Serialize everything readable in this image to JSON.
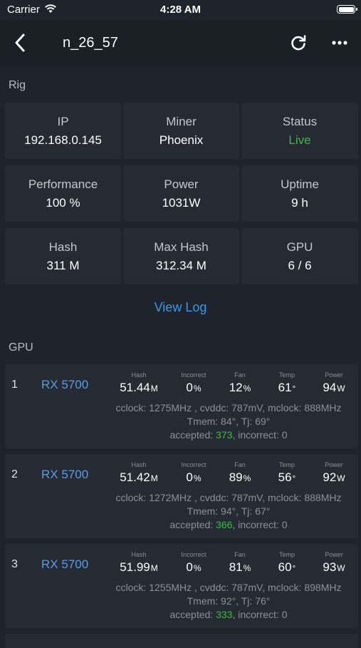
{
  "status_bar": {
    "carrier": "Carrier",
    "time": "4:28 AM"
  },
  "nav": {
    "title": "n_26_57"
  },
  "rig": {
    "section_label": "Rig",
    "cells": [
      {
        "label": "IP",
        "value": "192.168.0.145"
      },
      {
        "label": "Miner",
        "value": "Phoenix"
      },
      {
        "label": "Status",
        "value": "Live"
      },
      {
        "label": "Performance",
        "value": "100 %"
      },
      {
        "label": "Power",
        "value": "1031W"
      },
      {
        "label": "Uptime",
        "value": "9 h"
      },
      {
        "label": "Hash",
        "value": "311 M"
      },
      {
        "label": "Max Hash",
        "value": "312.34 M"
      },
      {
        "label": "GPU",
        "value": "6 / 6"
      }
    ],
    "view_log": "View Log",
    "status_color": "#3fb94a"
  },
  "gpu": {
    "section_label": "GPU",
    "metric_labels": {
      "hash": "Hash",
      "incorrect": "Incorrect",
      "fan": "Fan",
      "temp": "Temp",
      "power": "Power"
    },
    "units": {
      "hash": "M",
      "incorrect": "%",
      "fan": "%",
      "temp": "°",
      "power": "W"
    },
    "accepted_label": "accepted: ",
    "incorrect_label": ", incorrect: ",
    "cards": [
      {
        "index": "1",
        "model": "RX 5700",
        "hash": "51.44",
        "incorrect": "0",
        "fan": "12",
        "temp": "61",
        "power": "94",
        "clocks": "cclock: 1275MHz , cvddc: 787mV, mclock: 888MHz",
        "tmem": "Tmem: 84°, Tj: 69°",
        "accepted": "373",
        "incorrect_count": "0"
      },
      {
        "index": "2",
        "model": "RX 5700",
        "hash": "51.42",
        "incorrect": "0",
        "fan": "89",
        "temp": "56",
        "power": "92",
        "clocks": "cclock: 1272MHz , cvddc: 787mV, mclock: 888MHz",
        "tmem": "Tmem: 94°, Tj: 67°",
        "accepted": "366",
        "incorrect_count": "0"
      },
      {
        "index": "3",
        "model": "RX 5700",
        "hash": "51.99",
        "incorrect": "0",
        "fan": "81",
        "temp": "60",
        "power": "93",
        "clocks": "cclock: 1255MHz , cvddc: 787mV, mclock: 898MHz",
        "tmem": "Tmem: 92°, Tj: 76°",
        "accepted": "333",
        "incorrect_count": "0"
      }
    ]
  },
  "colors": {
    "accent": "#3a99e0",
    "model": "#5b9be0",
    "good": "#3fb94a"
  }
}
